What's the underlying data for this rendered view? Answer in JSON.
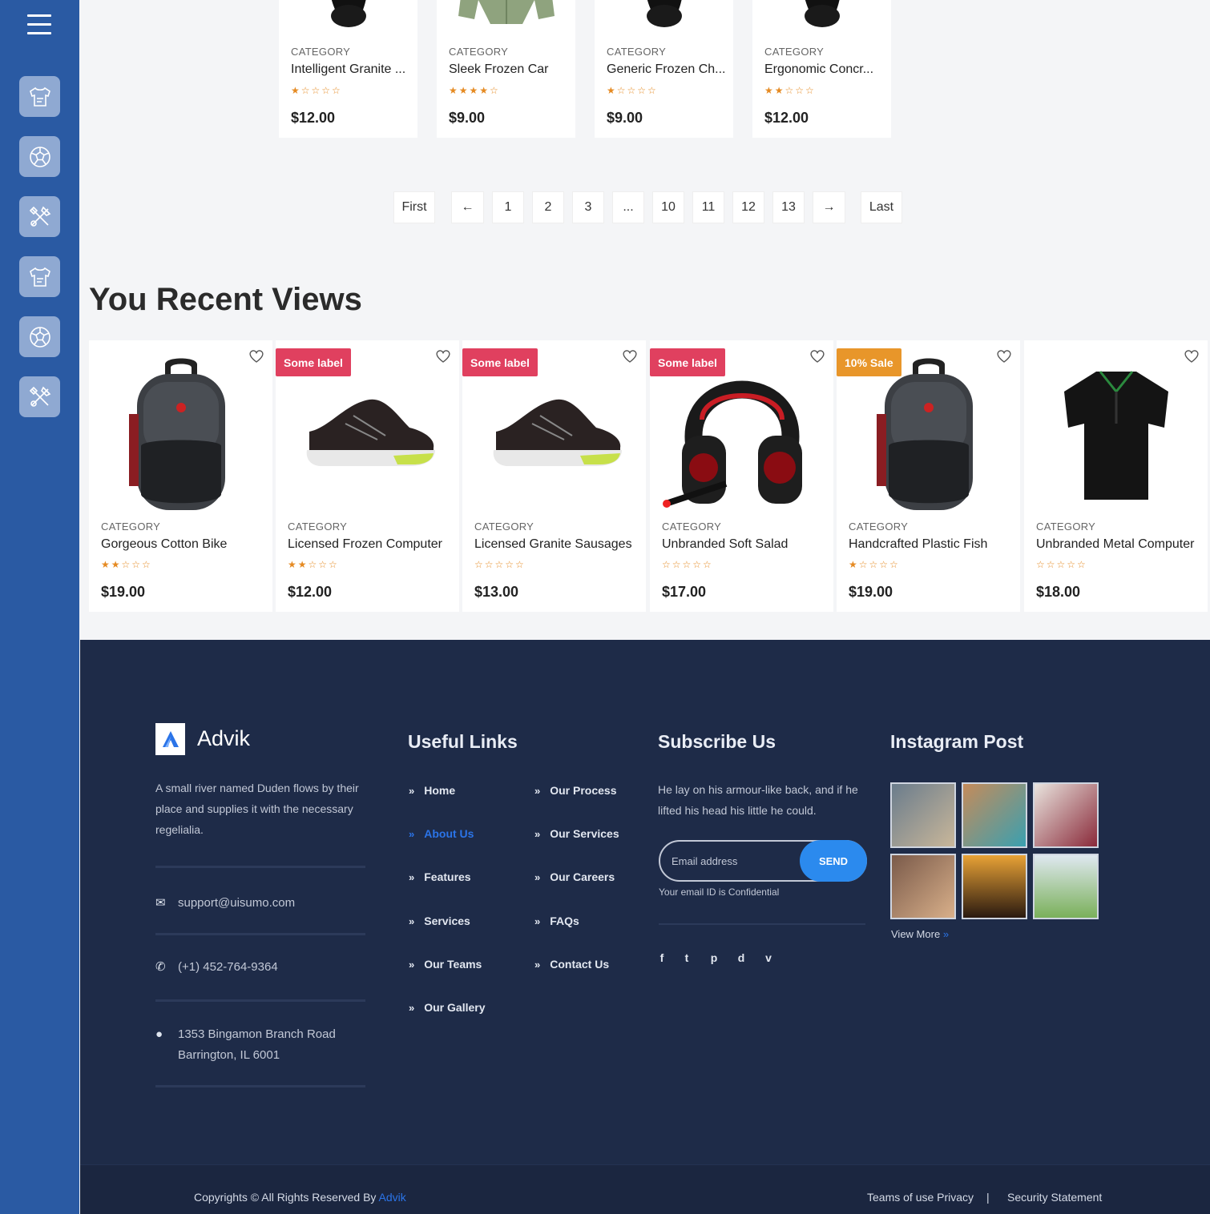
{
  "sidebar": {
    "items": [
      {
        "icon": "shirt-icon"
      },
      {
        "icon": "soccer-ball-icon"
      },
      {
        "icon": "tools-icon"
      },
      {
        "icon": "shirt-icon"
      },
      {
        "icon": "soccer-ball-icon"
      },
      {
        "icon": "tools-icon"
      }
    ]
  },
  "top_products": [
    {
      "category": "CATEGORY",
      "name": "Intelligent Granite ...",
      "rating": 1,
      "price": "$12.00",
      "image": "watch"
    },
    {
      "category": "CATEGORY",
      "name": "Sleek Frozen Car",
      "rating": 4,
      "price": "$9.00",
      "image": "jacket"
    },
    {
      "category": "CATEGORY",
      "name": "Generic Frozen Ch...",
      "rating": 1,
      "price": "$9.00",
      "image": "watch"
    },
    {
      "category": "CATEGORY",
      "name": "Ergonomic Concr...",
      "rating": 2,
      "price": "$12.00",
      "image": "watch"
    }
  ],
  "pagination": {
    "first": "First",
    "prev": "←",
    "pages": [
      "1",
      "2",
      "3",
      "...",
      "10",
      "11",
      "12",
      "13"
    ],
    "next": "→",
    "last": "Last"
  },
  "recent": {
    "title": "You Recent Views",
    "items": [
      {
        "category": "CATEGORY",
        "name": "Gorgeous Cotton Bike",
        "rating": 2,
        "price": "$19.00",
        "badge": "",
        "image": "backpack"
      },
      {
        "category": "CATEGORY",
        "name": "Licensed Frozen Computer",
        "rating": 2,
        "price": "$12.00",
        "badge": "Some label",
        "badge_color": "#e0405f",
        "image": "shoe"
      },
      {
        "category": "CATEGORY",
        "name": "Licensed Granite Sausages",
        "rating": 0,
        "price": "$13.00",
        "badge": "Some label",
        "badge_color": "#e0405f",
        "image": "shoe"
      },
      {
        "category": "CATEGORY",
        "name": "Unbranded Soft Salad",
        "rating": 0,
        "price": "$17.00",
        "badge": "Some label",
        "badge_color": "#e0405f",
        "image": "headset"
      },
      {
        "category": "CATEGORY",
        "name": "Handcrafted Plastic Fish",
        "rating": 1,
        "price": "$19.00",
        "badge": "10% Sale",
        "badge_color": "#e8962a",
        "image": "backpack"
      },
      {
        "category": "CATEGORY",
        "name": "Unbranded Metal Computer",
        "rating": 0,
        "price": "$18.00",
        "badge": "",
        "image": "polo"
      }
    ]
  },
  "footer": {
    "brand": "Advik",
    "about": "A small river named Duden flows by their place and supplies it with the necessary regelialia.",
    "email": "support@uisumo.com",
    "phone": "(+1) 452-764-9364",
    "address_line1": "1353 Bingamon Branch Road",
    "address_line2": "Barrington, IL 6001",
    "useful_links_title": "Useful Links",
    "links_col1": [
      "Home",
      "About Us",
      "Features",
      "Services",
      "Our Teams",
      "Our Gallery"
    ],
    "links_col2": [
      "Our Process",
      "Our Services",
      "Our Careers",
      "FAQs",
      "Contact Us"
    ],
    "subscribe_title": "Subscribe Us",
    "subscribe_text": "He lay on his armour-like back, and if he lifted his head his little he could.",
    "email_placeholder": "Email address",
    "send_label": "SEND",
    "confidential": "Your email ID is Confidential",
    "social": [
      "f",
      "t",
      "p",
      "d",
      "v"
    ],
    "instagram_title": "Instagram Post",
    "view_more": "View More",
    "copyright": "Copyrights © All Rights Reserved By ",
    "copyright_brand": "Advik",
    "terms": "Teams of use Privacy",
    "separator": "|",
    "security": "Security Statement"
  },
  "colors": {
    "sidebar": "#2a5aa3",
    "star": "#e58a22",
    "footer_bg": "#1e2b48",
    "accent": "#2b74e8"
  }
}
